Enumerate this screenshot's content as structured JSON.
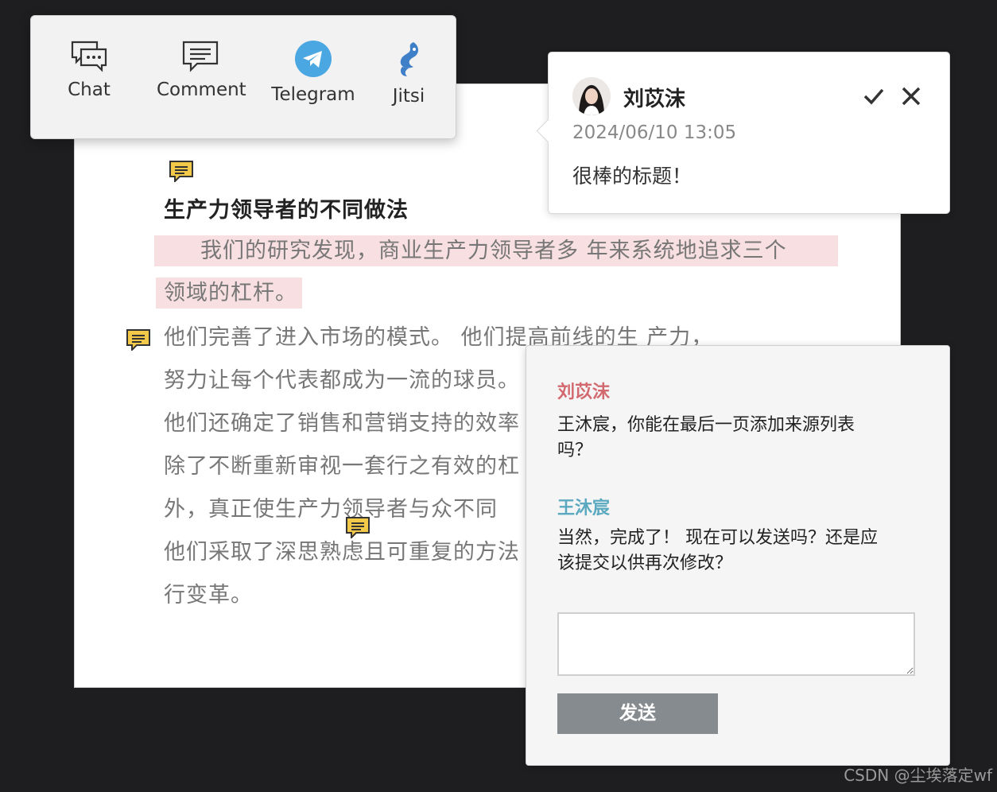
{
  "share_bar": {
    "items": [
      {
        "label": "Chat",
        "icon": "chat-bubbles-icon"
      },
      {
        "label": "Comment",
        "icon": "comment-icon"
      },
      {
        "label": "Telegram",
        "icon": "telegram-icon"
      },
      {
        "label": "Jitsi",
        "icon": "jitsi-icon"
      }
    ]
  },
  "document": {
    "title": "生产力领导者的不同做法",
    "highlight_line1": "我们的研究发现，商业生产力领导者多 年来系统地追求三个",
    "highlight_line2": "领域的杠杆。",
    "lines": [
      "他们完善了进入市场的模式。 他们提高前线的生 产力，",
      "努力让每个代表都成为一流的球员。",
      "他们还确定了销售和营销支持的效率",
      "除了不断重新审视一套行之有效的杠",
      "外，真正使生产力领导者与众不同",
      "他们采取了深思熟虑且可重复的方法",
      "行变革。"
    ],
    "note_icon_color": "#f3c94a"
  },
  "comment_popup": {
    "author": "刘苡沫",
    "date": "2024/06/10 13:05",
    "text": "很棒的标题！",
    "approve_icon": "check-icon",
    "close_icon": "close-icon"
  },
  "chat_panel": {
    "messages": [
      {
        "author": "刘苡沫",
        "color": "#d2696f",
        "text": "王沐宸，你能在最后一页添加来源列表吗？"
      },
      {
        "author": "王沐宸",
        "color": "#5aa9c0",
        "text": "当然，完成了！ 现在可以发送吗？还是应该提交以供再次修改？"
      }
    ],
    "input_value": "",
    "send_label": "发送"
  },
  "watermark": "CSDN @尘埃落定wf"
}
